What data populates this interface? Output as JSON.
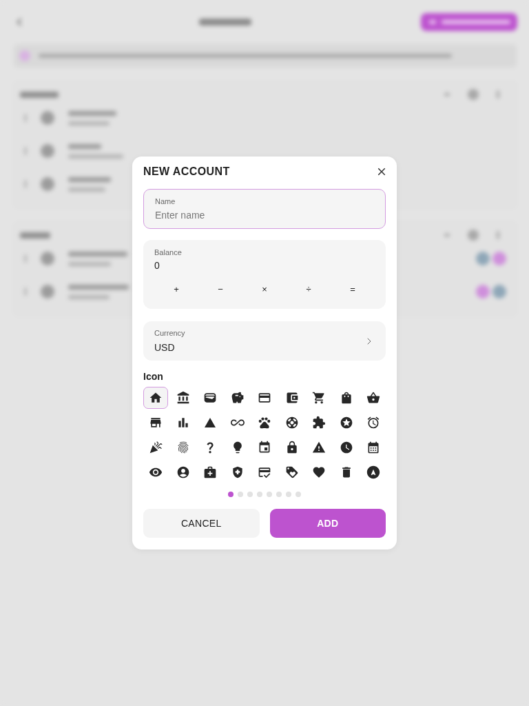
{
  "dialog": {
    "title": "NEW ACCOUNT"
  },
  "name_field": {
    "label": "Name",
    "placeholder": "Enter name",
    "focused": true
  },
  "balance_field": {
    "label": "Balance",
    "value": "0",
    "operators": [
      "+",
      "−",
      "×",
      "÷",
      "="
    ]
  },
  "currency_field": {
    "label": "Currency",
    "value": "USD"
  },
  "icon_picker": {
    "label": "Icon",
    "icons": [
      {
        "selected": true
      },
      {
        "selected": false
      },
      {
        "selected": false
      },
      {
        "selected": false
      },
      {
        "selected": false
      },
      {
        "selected": false
      },
      {
        "selected": false
      },
      {
        "selected": false
      },
      {
        "selected": false
      },
      {
        "selected": false
      },
      {
        "selected": false
      },
      {
        "selected": false
      },
      {
        "selected": false
      },
      {
        "selected": false
      },
      {
        "selected": false
      },
      {
        "selected": false
      },
      {
        "selected": false
      },
      {
        "selected": false
      },
      {
        "selected": false
      },
      {
        "selected": false
      },
      {
        "selected": false
      },
      {
        "selected": false
      },
      {
        "selected": false
      },
      {
        "selected": false
      },
      {
        "selected": false
      },
      {
        "selected": false
      },
      {
        "selected": false
      },
      {
        "selected": false
      },
      {
        "selected": false
      },
      {
        "selected": false
      },
      {
        "selected": false
      },
      {
        "selected": false
      },
      {
        "selected": false
      },
      {
        "selected": false
      },
      {
        "selected": false
      },
      {
        "selected": false
      }
    ],
    "pages": [
      {
        "selected": true
      },
      {
        "selected": false
      },
      {
        "selected": false
      },
      {
        "selected": false
      },
      {
        "selected": false
      },
      {
        "selected": false
      },
      {
        "selected": false
      },
      {
        "selected": false
      }
    ]
  },
  "buttons": [
    {
      "label": "CANCEL",
      "kind": "secondary"
    },
    {
      "label": "ADD",
      "kind": "primary"
    }
  ]
}
